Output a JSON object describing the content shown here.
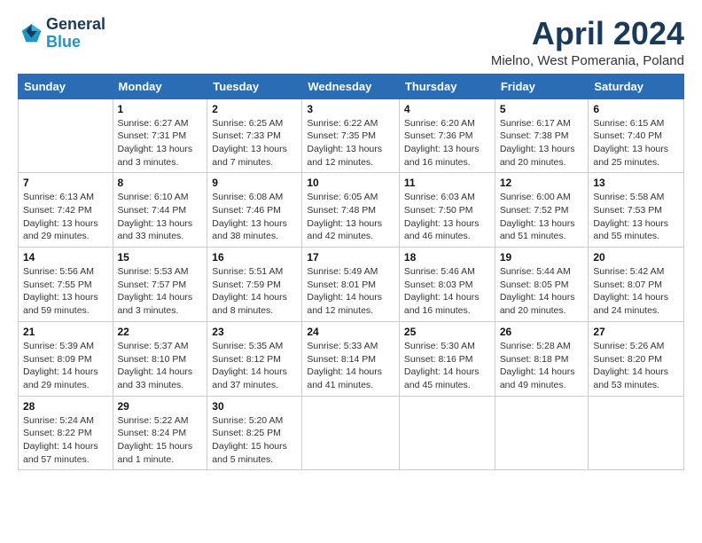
{
  "logo": {
    "line1": "General",
    "line2": "Blue"
  },
  "title": "April 2024",
  "location": "Mielno, West Pomerania, Poland",
  "header_days": [
    "Sunday",
    "Monday",
    "Tuesday",
    "Wednesday",
    "Thursday",
    "Friday",
    "Saturday"
  ],
  "weeks": [
    [
      {
        "day": "",
        "sunrise": "",
        "sunset": "",
        "daylight": ""
      },
      {
        "day": "1",
        "sunrise": "Sunrise: 6:27 AM",
        "sunset": "Sunset: 7:31 PM",
        "daylight": "Daylight: 13 hours and 3 minutes."
      },
      {
        "day": "2",
        "sunrise": "Sunrise: 6:25 AM",
        "sunset": "Sunset: 7:33 PM",
        "daylight": "Daylight: 13 hours and 7 minutes."
      },
      {
        "day": "3",
        "sunrise": "Sunrise: 6:22 AM",
        "sunset": "Sunset: 7:35 PM",
        "daylight": "Daylight: 13 hours and 12 minutes."
      },
      {
        "day": "4",
        "sunrise": "Sunrise: 6:20 AM",
        "sunset": "Sunset: 7:36 PM",
        "daylight": "Daylight: 13 hours and 16 minutes."
      },
      {
        "day": "5",
        "sunrise": "Sunrise: 6:17 AM",
        "sunset": "Sunset: 7:38 PM",
        "daylight": "Daylight: 13 hours and 20 minutes."
      },
      {
        "day": "6",
        "sunrise": "Sunrise: 6:15 AM",
        "sunset": "Sunset: 7:40 PM",
        "daylight": "Daylight: 13 hours and 25 minutes."
      }
    ],
    [
      {
        "day": "7",
        "sunrise": "Sunrise: 6:13 AM",
        "sunset": "Sunset: 7:42 PM",
        "daylight": "Daylight: 13 hours and 29 minutes."
      },
      {
        "day": "8",
        "sunrise": "Sunrise: 6:10 AM",
        "sunset": "Sunset: 7:44 PM",
        "daylight": "Daylight: 13 hours and 33 minutes."
      },
      {
        "day": "9",
        "sunrise": "Sunrise: 6:08 AM",
        "sunset": "Sunset: 7:46 PM",
        "daylight": "Daylight: 13 hours and 38 minutes."
      },
      {
        "day": "10",
        "sunrise": "Sunrise: 6:05 AM",
        "sunset": "Sunset: 7:48 PM",
        "daylight": "Daylight: 13 hours and 42 minutes."
      },
      {
        "day": "11",
        "sunrise": "Sunrise: 6:03 AM",
        "sunset": "Sunset: 7:50 PM",
        "daylight": "Daylight: 13 hours and 46 minutes."
      },
      {
        "day": "12",
        "sunrise": "Sunrise: 6:00 AM",
        "sunset": "Sunset: 7:52 PM",
        "daylight": "Daylight: 13 hours and 51 minutes."
      },
      {
        "day": "13",
        "sunrise": "Sunrise: 5:58 AM",
        "sunset": "Sunset: 7:53 PM",
        "daylight": "Daylight: 13 hours and 55 minutes."
      }
    ],
    [
      {
        "day": "14",
        "sunrise": "Sunrise: 5:56 AM",
        "sunset": "Sunset: 7:55 PM",
        "daylight": "Daylight: 13 hours and 59 minutes."
      },
      {
        "day": "15",
        "sunrise": "Sunrise: 5:53 AM",
        "sunset": "Sunset: 7:57 PM",
        "daylight": "Daylight: 14 hours and 3 minutes."
      },
      {
        "day": "16",
        "sunrise": "Sunrise: 5:51 AM",
        "sunset": "Sunset: 7:59 PM",
        "daylight": "Daylight: 14 hours and 8 minutes."
      },
      {
        "day": "17",
        "sunrise": "Sunrise: 5:49 AM",
        "sunset": "Sunset: 8:01 PM",
        "daylight": "Daylight: 14 hours and 12 minutes."
      },
      {
        "day": "18",
        "sunrise": "Sunrise: 5:46 AM",
        "sunset": "Sunset: 8:03 PM",
        "daylight": "Daylight: 14 hours and 16 minutes."
      },
      {
        "day": "19",
        "sunrise": "Sunrise: 5:44 AM",
        "sunset": "Sunset: 8:05 PM",
        "daylight": "Daylight: 14 hours and 20 minutes."
      },
      {
        "day": "20",
        "sunrise": "Sunrise: 5:42 AM",
        "sunset": "Sunset: 8:07 PM",
        "daylight": "Daylight: 14 hours and 24 minutes."
      }
    ],
    [
      {
        "day": "21",
        "sunrise": "Sunrise: 5:39 AM",
        "sunset": "Sunset: 8:09 PM",
        "daylight": "Daylight: 14 hours and 29 minutes."
      },
      {
        "day": "22",
        "sunrise": "Sunrise: 5:37 AM",
        "sunset": "Sunset: 8:10 PM",
        "daylight": "Daylight: 14 hours and 33 minutes."
      },
      {
        "day": "23",
        "sunrise": "Sunrise: 5:35 AM",
        "sunset": "Sunset: 8:12 PM",
        "daylight": "Daylight: 14 hours and 37 minutes."
      },
      {
        "day": "24",
        "sunrise": "Sunrise: 5:33 AM",
        "sunset": "Sunset: 8:14 PM",
        "daylight": "Daylight: 14 hours and 41 minutes."
      },
      {
        "day": "25",
        "sunrise": "Sunrise: 5:30 AM",
        "sunset": "Sunset: 8:16 PM",
        "daylight": "Daylight: 14 hours and 45 minutes."
      },
      {
        "day": "26",
        "sunrise": "Sunrise: 5:28 AM",
        "sunset": "Sunset: 8:18 PM",
        "daylight": "Daylight: 14 hours and 49 minutes."
      },
      {
        "day": "27",
        "sunrise": "Sunrise: 5:26 AM",
        "sunset": "Sunset: 8:20 PM",
        "daylight": "Daylight: 14 hours and 53 minutes."
      }
    ],
    [
      {
        "day": "28",
        "sunrise": "Sunrise: 5:24 AM",
        "sunset": "Sunset: 8:22 PM",
        "daylight": "Daylight: 14 hours and 57 minutes."
      },
      {
        "day": "29",
        "sunrise": "Sunrise: 5:22 AM",
        "sunset": "Sunset: 8:24 PM",
        "daylight": "Daylight: 15 hours and 1 minute."
      },
      {
        "day": "30",
        "sunrise": "Sunrise: 5:20 AM",
        "sunset": "Sunset: 8:25 PM",
        "daylight": "Daylight: 15 hours and 5 minutes."
      },
      {
        "day": "",
        "sunrise": "",
        "sunset": "",
        "daylight": ""
      },
      {
        "day": "",
        "sunrise": "",
        "sunset": "",
        "daylight": ""
      },
      {
        "day": "",
        "sunrise": "",
        "sunset": "",
        "daylight": ""
      },
      {
        "day": "",
        "sunrise": "",
        "sunset": "",
        "daylight": ""
      }
    ]
  ]
}
